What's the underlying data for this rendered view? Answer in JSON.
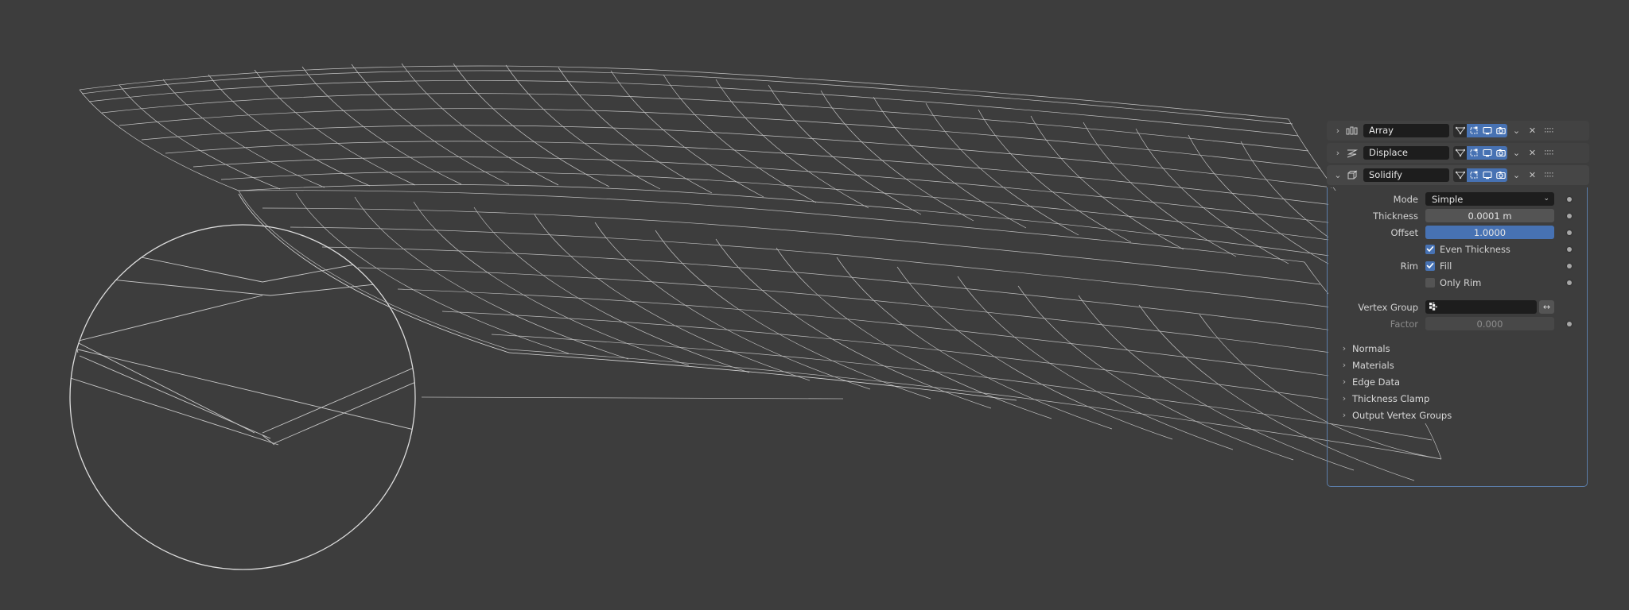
{
  "app": "Blender Modifier Properties",
  "viewport": {
    "label": "3d-viewport",
    "background_color": "#3d3d3d",
    "wire_color": "#d8d8d8",
    "description": "Wireframe displaced grid plane with circular zoom callout showing solidified thin edge"
  },
  "modifier_stack": [
    {
      "name": "Array",
      "icon": "array-icon",
      "expanded": false,
      "expander_glyph": "›",
      "toggles": [
        {
          "name": "edit-mode-toggle",
          "icon": "edit-mode-icon",
          "on": false
        },
        {
          "name": "on-cage-toggle",
          "icon": "on-cage-icon",
          "on": true
        },
        {
          "name": "realtime-toggle",
          "icon": "display-icon",
          "on": true
        },
        {
          "name": "render-toggle",
          "icon": "camera-icon",
          "on": true
        }
      ],
      "dropdown_glyph": "⌄",
      "close_glyph": "✕"
    },
    {
      "name": "Displace",
      "icon": "displace-icon",
      "expanded": false,
      "expander_glyph": "›",
      "toggles": [
        {
          "name": "edit-mode-toggle",
          "icon": "edit-mode-icon",
          "on": false
        },
        {
          "name": "on-cage-toggle",
          "icon": "on-cage-icon",
          "on": true
        },
        {
          "name": "realtime-toggle",
          "icon": "display-icon",
          "on": true
        },
        {
          "name": "render-toggle",
          "icon": "camera-icon",
          "on": true
        }
      ],
      "dropdown_glyph": "⌄",
      "close_glyph": "✕"
    },
    {
      "name": "Solidify",
      "icon": "solidify-icon",
      "expanded": true,
      "expander_glyph": "⌄",
      "toggles": [
        {
          "name": "edit-mode-toggle",
          "icon": "edit-mode-icon",
          "on": false
        },
        {
          "name": "on-cage-toggle",
          "icon": "on-cage-icon",
          "on": true
        },
        {
          "name": "realtime-toggle",
          "icon": "display-icon",
          "on": true
        },
        {
          "name": "render-toggle",
          "icon": "camera-icon",
          "on": true
        }
      ],
      "dropdown_glyph": "⌄",
      "close_glyph": "✕"
    }
  ],
  "solidify": {
    "mode": {
      "label": "Mode",
      "value": "Simple",
      "chevron": "⌄"
    },
    "thickness": {
      "label": "Thickness",
      "value": "0.0001 m"
    },
    "offset": {
      "label": "Offset",
      "value": "1.0000",
      "fill_percent": 100
    },
    "even_thickness": {
      "label": "Even Thickness",
      "checked": true,
      "check": "✓"
    },
    "rim": {
      "label": "Rim",
      "fill_label": "Fill",
      "fill_checked": true,
      "check": "✓"
    },
    "only_rim": {
      "label": "Only Rim",
      "checked": false
    },
    "vertex_group": {
      "label": "Vertex Group",
      "value": "",
      "icon": "vertex-group-icon",
      "invert_glyph": "↔"
    },
    "factor": {
      "label": "Factor",
      "value": "0.000",
      "disabled": true
    },
    "subpanels": [
      {
        "label": "Normals",
        "arrow": "›"
      },
      {
        "label": "Materials",
        "arrow": "›"
      },
      {
        "label": "Edge Data",
        "arrow": "›"
      },
      {
        "label": "Thickness Clamp",
        "arrow": "›"
      },
      {
        "label": "Output Vertex Groups",
        "arrow": "›"
      }
    ]
  },
  "colors": {
    "accent_blue": "#4772b3",
    "panel_bg": "#3d3d3d",
    "row_bg": "#424242",
    "field_dark": "#1d1d1d",
    "field_grey": "#545454",
    "outline": "#5b7da8"
  }
}
